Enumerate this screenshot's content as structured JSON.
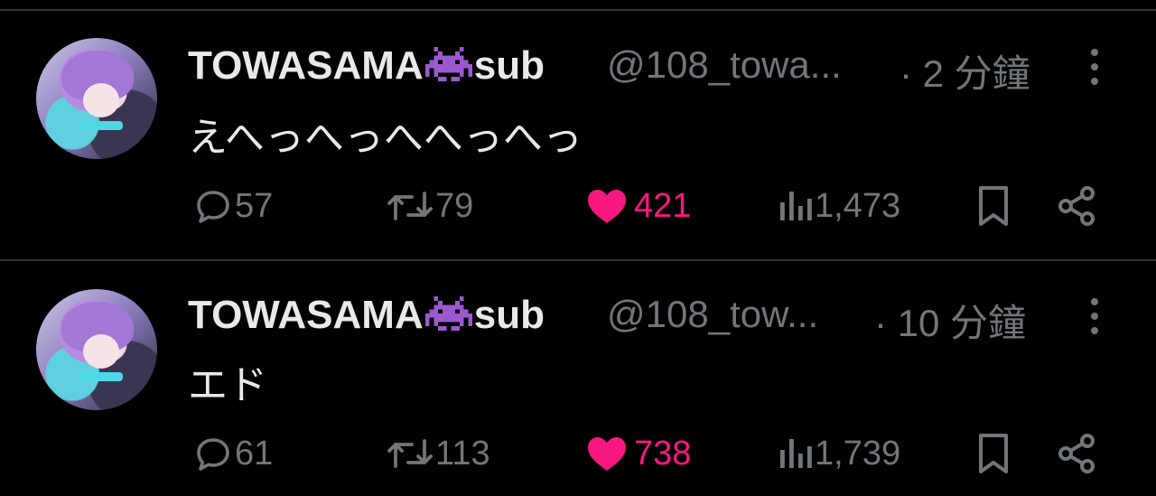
{
  "tweets": [
    {
      "display_name_pre": "TOWASAMA",
      "display_name_post": "sub",
      "handle": "@108_towa...",
      "time": "· 2 分鐘",
      "text": "えへっへっへへっへっ",
      "replies": "57",
      "retweets": "79",
      "likes": "421",
      "views": "1,473"
    },
    {
      "display_name_pre": "TOWASAMA",
      "display_name_post": "sub",
      "handle": "@108_tow...",
      "time": "· 10 分鐘",
      "text": "エド",
      "replies": "61",
      "retweets": "113",
      "likes": "738",
      "views": "1,739"
    }
  ],
  "icons": {
    "reply": "reply-icon",
    "retweet": "retweet-icon",
    "like": "heart-icon",
    "views": "analytics-icon",
    "bookmark": "bookmark-icon",
    "share": "share-icon",
    "more": "more-icon",
    "invader": "alien-monster-icon"
  },
  "colors": {
    "background": "#000000",
    "text": "#e7e9ea",
    "muted": "#71767b",
    "like": "#f91880",
    "invader": "#9b59d0",
    "divider": "#2f3336"
  }
}
